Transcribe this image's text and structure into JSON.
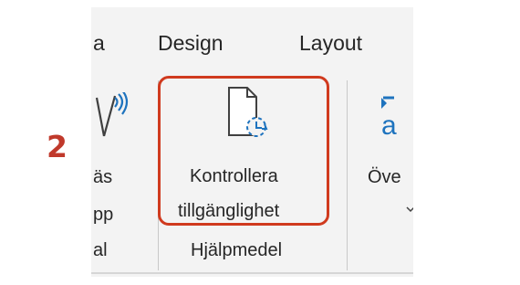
{
  "annotation": {
    "step_number": "2"
  },
  "ribbon": {
    "tabs": [
      {
        "label": "a"
      },
      {
        "label": "Design"
      },
      {
        "label": "Layout"
      }
    ],
    "read_aloud": {
      "line1": "äs",
      "line2": "pp",
      "group": "al",
      "icon": "read-aloud-icon"
    },
    "check_accessibility": {
      "line1": "Kontrollera",
      "line2": "tillgänglighet",
      "icon": "check-accessibility-icon"
    },
    "accessibility_group": {
      "label": "Hjälpmedel"
    },
    "translate": {
      "label": "Öve",
      "icon": "translate-icon"
    },
    "colors": {
      "highlight": "#d03a1e",
      "accent_blue": "#1e73be",
      "annotation": "#c0392b"
    }
  }
}
